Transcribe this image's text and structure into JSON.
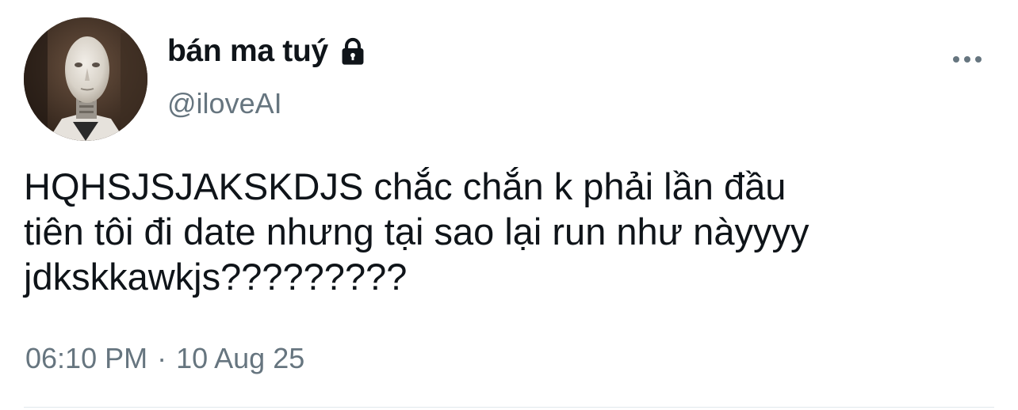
{
  "user": {
    "display_name": "bán ma tuý",
    "handle": "@iloveAI",
    "avatar_icon": "robot-avatar",
    "protected_icon": "lock-icon"
  },
  "menu": {
    "more_icon": "more-horizontal-icon"
  },
  "tweet": {
    "text": "HQHSJSJAKSKDJS chắc chắn k phải lần đầu\ntiên tôi đi date nhưng tại sao lại run như nàyyyy\njdkskkawkjs?????????",
    "time": "06:10 PM",
    "separator": "·",
    "date": "10 Aug 25"
  },
  "colors": {
    "text": "#0f1419",
    "secondary": "#66757f",
    "divider": "#e1e8ed"
  }
}
